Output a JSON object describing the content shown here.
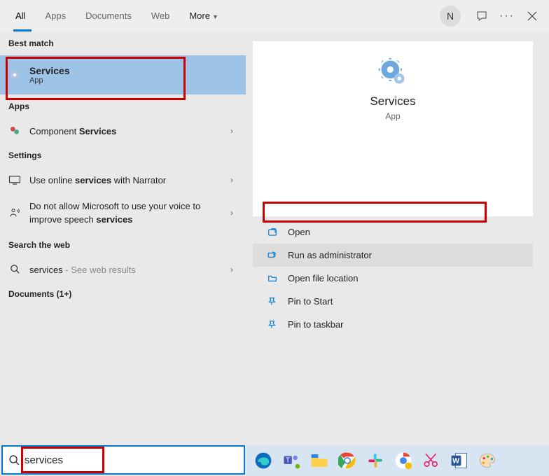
{
  "tabs": {
    "all": "All",
    "apps": "Apps",
    "documents": "Documents",
    "web": "Web",
    "more": "More"
  },
  "avatar": "N",
  "sections": {
    "best_match": "Best match",
    "apps": "Apps",
    "settings": "Settings",
    "search_web": "Search the web",
    "documents": "Documents (1+)"
  },
  "best": {
    "title": "Services",
    "sub": "App"
  },
  "apps_row": {
    "pre": "Component ",
    "bold": "Services"
  },
  "settings1": {
    "pre": "Use online ",
    "bold": "services",
    "post": " with Narrator"
  },
  "settings2": {
    "pre": "Do not allow Microsoft to use your voice to improve speech ",
    "bold": "services"
  },
  "webrow": {
    "term": "services",
    "suffix": " - See web results"
  },
  "preview": {
    "title": "Services",
    "sub": "App"
  },
  "actions": {
    "open": "Open",
    "admin": "Run as administrator",
    "loc": "Open file location",
    "pinstart": "Pin to Start",
    "pintask": "Pin to taskbar"
  },
  "search": {
    "value": "services"
  }
}
